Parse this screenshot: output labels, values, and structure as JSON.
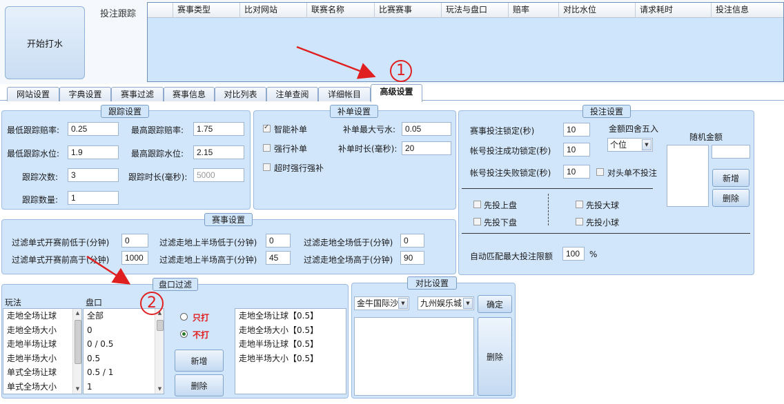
{
  "start_button": "开始打水",
  "tracking": {
    "label": "投注跟踪",
    "columns": [
      "赛事类型",
      "比对网站",
      "联赛名称",
      "比赛赛事",
      "玩法与盘口",
      "赔率",
      "对比水位",
      "请求耗时",
      "投注信息"
    ]
  },
  "tabs": [
    "网站设置",
    "字典设置",
    "赛事过滤",
    "赛事信息",
    "对比列表",
    "注单查阅",
    "详细帐目",
    "高级设置"
  ],
  "active_tab": "高级设置",
  "track_settings": {
    "title": "跟踪设置",
    "min_odds_label": "最低跟踪赔率:",
    "min_odds": "0.25",
    "max_odds_label": "最高跟踪赔率:",
    "max_odds": "1.75",
    "min_water_label": "最低跟踪水位:",
    "min_water": "1.9",
    "max_water_label": "最高跟踪水位:",
    "max_water": "2.15",
    "count_label": "跟踪次数:",
    "count": "3",
    "duration_label": "跟踪时长(毫秒):",
    "duration": "5000",
    "qty_label": "跟踪数量:",
    "qty": "1"
  },
  "supplement": {
    "title": "补单设置",
    "smart_label": "智能补单",
    "max_loss_label": "补单最大亏水:",
    "max_loss": "0.05",
    "force_label": "强行补单",
    "duration_label": "补单时长(毫秒):",
    "duration": "20",
    "timeout_label": "超时强行强补"
  },
  "bet_settings": {
    "title": "投注设置",
    "event_lock_label": "赛事投注锁定(秒)",
    "event_lock": "10",
    "rounding_label": "金额四舍五入",
    "rounding_value": "个位",
    "random_amount_label": "随机金额",
    "success_lock_label": "帐号投注成功锁定(秒)",
    "success_lock": "10",
    "fail_lock_label": "帐号投注失败锁定(秒)",
    "fail_lock": "10",
    "no_head_label": "对头单不投注",
    "add_label": "新增",
    "delete_label": "删除",
    "first_upper": "先投上盘",
    "first_lower": "先投下盘",
    "first_big": "先投大球",
    "first_small": "先投小球",
    "auto_limit_label": "自动匹配最大投注限额",
    "auto_limit": "100",
    "percent": "%"
  },
  "event_settings": {
    "title": "赛事设置",
    "f1_label": "过滤单式开赛前低于(分钟)",
    "f1": "0",
    "f2_label": "过滤走地上半场低于(分钟)",
    "f2": "0",
    "f3_label": "过滤走地全场低于(分钟)",
    "f3": "0",
    "f4_label": "过滤单式开赛前高于(分钟)",
    "f4": "1000",
    "f5_label": "过滤走地上半场高于(分钟)",
    "f5": "45",
    "f6_label": "过滤走地全场高于(分钟)",
    "f6": "90"
  },
  "handicap_filter": {
    "title": "盘口过滤",
    "play_label": "玩法",
    "line_label": "盘口",
    "plays": [
      "走地全场让球",
      "走地全场大小",
      "走地半场让球",
      "走地半场大小",
      "单式全场让球",
      "单式全场大小"
    ],
    "lines": [
      "全部",
      "0",
      "0 / 0.5",
      "0.5",
      "0.5 / 1",
      "1"
    ],
    "only_label": "只打",
    "not_label": "不打",
    "add_label": "新增",
    "delete_label": "删除",
    "result": [
      "走地全场让球【0.5】",
      "走地全场大小【0.5】",
      "走地半场让球【0.5】",
      "走地半场大小【0.5】"
    ]
  },
  "compare_settings": {
    "title": "对比设置",
    "site_a": "金牛国际沙",
    "site_b": "九州娱乐城",
    "confirm_label": "确定",
    "delete_label": "删除"
  },
  "annotations": [
    "1",
    "2"
  ],
  "colors": {
    "panel": "#d2e6fb",
    "grid": "#cfe5fb",
    "accent_red": "#e31b1b"
  }
}
